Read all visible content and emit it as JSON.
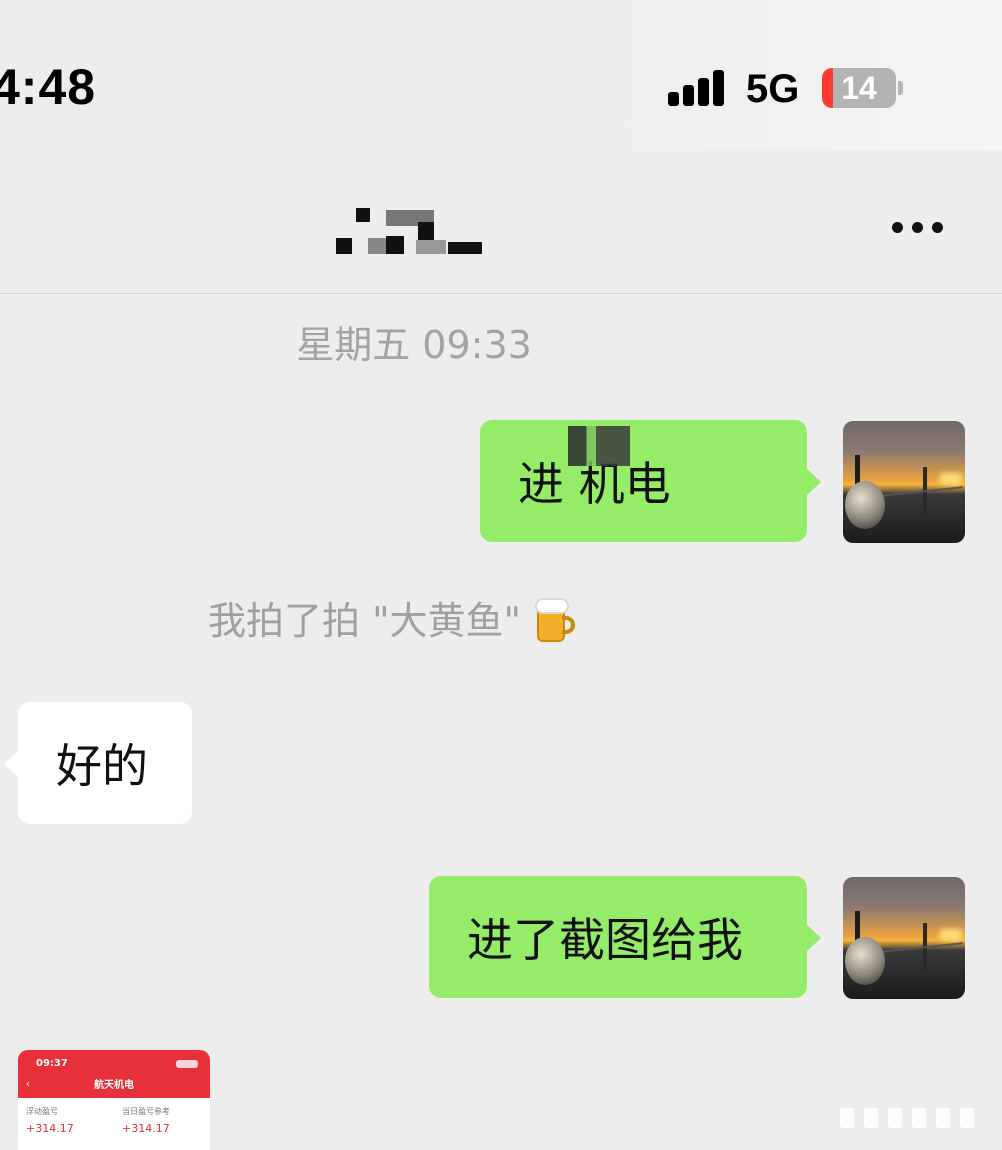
{
  "status_bar": {
    "time": "4:48",
    "network": "5G",
    "battery": "14",
    "battery_level_percent": 14,
    "battery_low_color": "#ff3b30"
  },
  "nav": {
    "more_icon": "ellipsis-icon"
  },
  "chat": {
    "timestamp": "星期五 09:33",
    "messages": [
      {
        "side": "right",
        "text": "进 机电"
      },
      {
        "side": "left",
        "text": "好的"
      },
      {
        "side": "right",
        "text": "进了截图给我"
      }
    ],
    "system_notice": "我拍了拍 \"大黄鱼\"",
    "system_notice_icon": "beer-mug-icon",
    "colors": {
      "sent_bubble": "#95ec69",
      "received_bubble": "#ffffff",
      "background": "#ededed"
    }
  },
  "image_message": {
    "time": "09:37",
    "title": "航天机电",
    "left_label": "浮动盈亏",
    "left_value": "+314.17",
    "right_label": "当日盈亏参考",
    "right_value": "+314.17",
    "accent": "#e8303a"
  }
}
